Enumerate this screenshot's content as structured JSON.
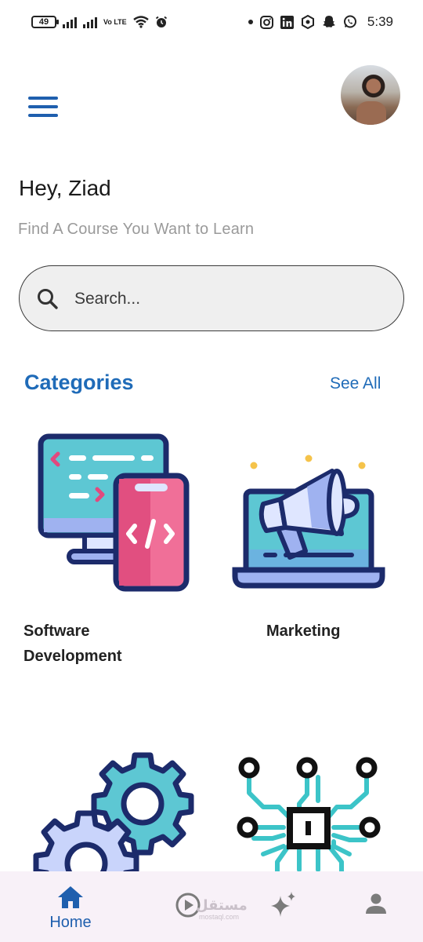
{
  "status_bar": {
    "battery": "49",
    "network": "Vo LTE",
    "time": "5:39",
    "icons": [
      "signal-icon",
      "signal-icon",
      "volte-icon",
      "wifi-icon",
      "alarm-icon",
      "notification-dot-icon",
      "instagram-icon",
      "linkedin-icon",
      "app-icon",
      "snapchat-icon",
      "whatsapp-icon"
    ]
  },
  "header": {
    "menu_icon": "hamburger-menu-icon",
    "avatar": "user-avatar"
  },
  "greeting": {
    "title": "Hey, Ziad",
    "subtitle": "Find A Course You Want to Learn"
  },
  "search": {
    "placeholder": "Search...",
    "value": "",
    "icon": "search-icon"
  },
  "categories": {
    "title": "Categories",
    "see_all": "See All",
    "items": [
      {
        "label": "Software Development",
        "icon": "software-development-icon"
      },
      {
        "label": "Marketing",
        "icon": "marketing-megaphone-icon"
      },
      {
        "label": "",
        "icon": "gears-icon"
      },
      {
        "label": "",
        "icon": "circuit-chip-icon"
      }
    ]
  },
  "bottom_nav": {
    "items": [
      {
        "label": "Home",
        "icon": "home-icon",
        "active": true
      },
      {
        "label": "",
        "icon": "play-circle-icon",
        "active": false
      },
      {
        "label": "",
        "icon": "sparkles-icon",
        "active": false
      },
      {
        "label": "",
        "icon": "person-icon",
        "active": false
      }
    ],
    "watermark": "مستقل",
    "watermark_sub": "mostaql.com"
  },
  "colors": {
    "primary": "#1f6bb8",
    "nav_background": "#f8f1f8",
    "search_background": "#efefef",
    "subtitle": "#9a9a9a"
  }
}
